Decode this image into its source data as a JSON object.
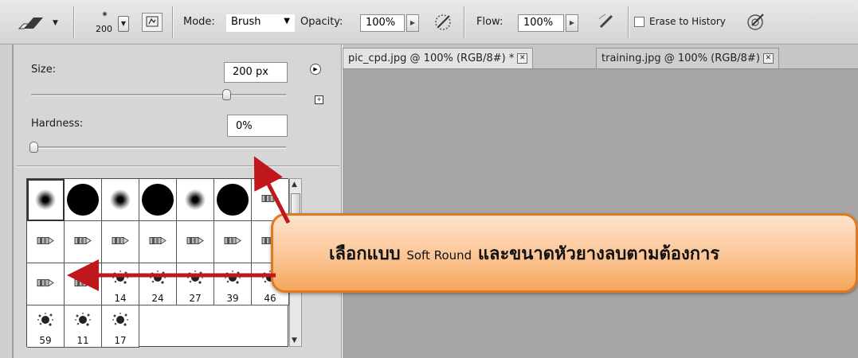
{
  "options_bar": {
    "brush_size": "200",
    "mode_label": "Mode:",
    "mode_value": "Brush",
    "opacity_label": "Opacity:",
    "opacity_value": "100%",
    "flow_label": "Flow:",
    "flow_value": "100%",
    "erase_to_history_label": "Erase to History",
    "erase_to_history_checked": false
  },
  "brush_panel": {
    "size_label": "Size:",
    "size_value": "200 px",
    "size_fraction": 0.77,
    "hardness_label": "Hardness:",
    "hardness_value": "0%",
    "hardness_fraction": 0.0,
    "presets": [
      {
        "kind": "soft",
        "size": "s"
      },
      {
        "kind": "hard",
        "size": "l"
      },
      {
        "kind": "soft",
        "size": "s"
      },
      {
        "kind": "hard",
        "size": "l"
      },
      {
        "kind": "soft",
        "size": "s"
      },
      {
        "kind": "hard",
        "size": "l"
      },
      {
        "kind": "tip",
        "label": ""
      },
      {
        "kind": "tip",
        "label": ""
      },
      {
        "kind": "tip",
        "label": ""
      },
      {
        "kind": "tip",
        "label": ""
      },
      {
        "kind": "tip",
        "label": ""
      },
      {
        "kind": "tip",
        "label": ""
      },
      {
        "kind": "tip",
        "label": ""
      },
      {
        "kind": "tip",
        "label": ""
      },
      {
        "kind": "tip",
        "label": ""
      },
      {
        "kind": "tip",
        "label": ""
      },
      {
        "kind": "scatter",
        "label": "14"
      },
      {
        "kind": "scatter",
        "label": "24"
      },
      {
        "kind": "scatter",
        "label": "27"
      },
      {
        "kind": "scatter",
        "label": "39"
      },
      {
        "kind": "scatter",
        "label": "46"
      },
      {
        "kind": "scatter",
        "label": "59"
      },
      {
        "kind": "scatter",
        "label": "11"
      },
      {
        "kind": "scatter",
        "label": "17"
      }
    ]
  },
  "tabs": [
    {
      "label": "pic_cpd.jpg @ 100% (RGB/8#) *",
      "active": true
    },
    {
      "label": "training.jpg @ 100% (RGB/8#)",
      "active": false
    }
  ],
  "callout": {
    "text_before": "เลือกแบบ",
    "text_english": "Soft Round",
    "text_after": "และขนาดหัวยางลบตามต้องการ"
  },
  "colors": {
    "callout_border": "#e07a20",
    "arrow": "#c0171c",
    "workspace": "#a6a6a6"
  }
}
